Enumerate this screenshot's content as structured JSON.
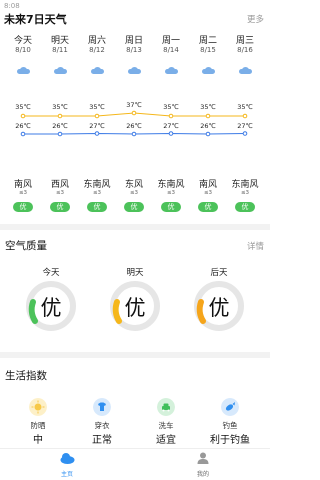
{
  "status": {
    "time": "8:08"
  },
  "forecast": {
    "title": "未来7日天气",
    "more": "更多",
    "days": [
      {
        "name": "今天",
        "date": "8/10",
        "high": "35℃",
        "low": "26℃",
        "wind": "南风",
        "wind_level": "≤3",
        "aqi": "优"
      },
      {
        "name": "明天",
        "date": "8/11",
        "high": "35℃",
        "low": "26℃",
        "wind": "西风",
        "wind_level": "≤3",
        "aqi": "优"
      },
      {
        "name": "周六",
        "date": "8/12",
        "high": "35℃",
        "low": "27℃",
        "wind": "东南风",
        "wind_level": "≤3",
        "aqi": "优"
      },
      {
        "name": "周日",
        "date": "8/13",
        "high": "37℃",
        "low": "26℃",
        "wind": "东风",
        "wind_level": "≤3",
        "aqi": "优"
      },
      {
        "name": "周一",
        "date": "8/14",
        "high": "35℃",
        "low": "27℃",
        "wind": "东南风",
        "wind_level": "≤3",
        "aqi": "优"
      },
      {
        "name": "周二",
        "date": "8/15",
        "high": "35℃",
        "low": "26℃",
        "wind": "南风",
        "wind_level": "≤3",
        "aqi": "优"
      },
      {
        "name": "周三",
        "date": "8/16",
        "high": "35℃",
        "low": "27℃",
        "wind": "东南风",
        "wind_level": "≤3",
        "aqi": "优"
      }
    ],
    "high_values": [
      35,
      35,
      35,
      37,
      35,
      35,
      35
    ],
    "low_values": [
      26,
      26,
      27,
      26,
      27,
      26,
      27
    ],
    "colors": {
      "high": "#f5b71b",
      "low": "#3d7be6",
      "aqi_good": "#4cc25a"
    }
  },
  "air_quality": {
    "title": "空气质量",
    "more": "详情",
    "days": [
      {
        "name": "今天",
        "level": "优"
      },
      {
        "name": "明天",
        "level": "优"
      },
      {
        "name": "后天",
        "level": "优"
      }
    ]
  },
  "life_index": {
    "title": "生活指数",
    "items": [
      {
        "icon": "sun-icon",
        "label": "防晒",
        "value": "中",
        "color": "#f7c948"
      },
      {
        "icon": "shirt-icon",
        "label": "穿衣",
        "value": "正常",
        "color": "#2f8ff0"
      },
      {
        "icon": "car-icon",
        "label": "洗车",
        "value": "适宜",
        "color": "#3fbf5a"
      },
      {
        "icon": "fish-icon",
        "label": "钓鱼",
        "value": "利于钓鱼",
        "color": "#2f8ff0"
      }
    ]
  },
  "nav": {
    "home": "主页",
    "mine": "我的",
    "active_color": "#2f8ff0"
  }
}
